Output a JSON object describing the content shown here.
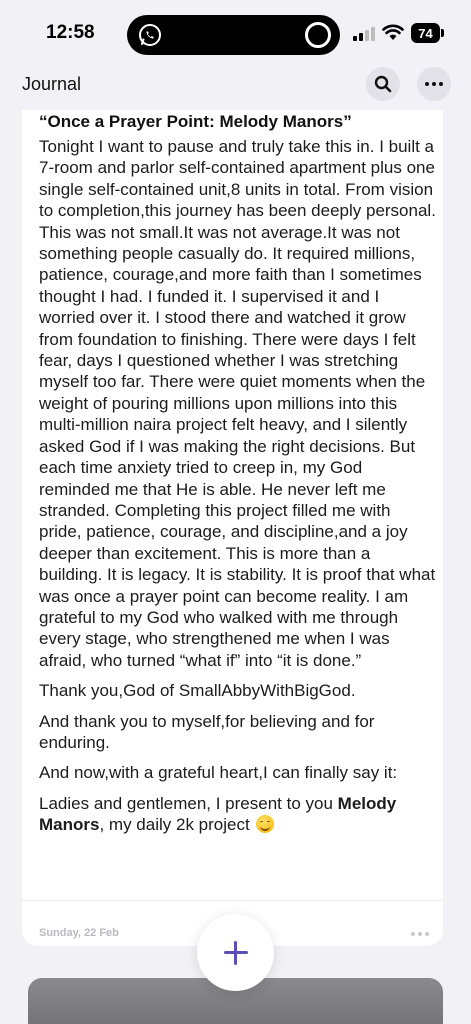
{
  "status_bar": {
    "time": "12:58",
    "battery": "74",
    "icons": [
      "whatsapp-icon",
      "ring-icon",
      "signal-icon",
      "wifi-icon",
      "battery-icon"
    ]
  },
  "nav": {
    "title": "Journal",
    "actions": [
      "search-icon",
      "more-icon"
    ]
  },
  "entry": {
    "title": "“Once a Prayer Point: Melody Manors”",
    "body": "Tonight I want to pause and truly take this in. I built a 7-room and parlor self-contained apartment plus one single self-contained unit,8 units in total. From vision to completion,this journey has been deeply personal. This was not small.It was not average.It was not something people casually do. It required millions, patience, courage,and more faith than I sometimes thought I had. I funded it. I supervised it and I worried over it. I stood there and watched it grow from foundation to finishing. There were days I felt fear, days I questioned whether I was stretching myself too far. There were quiet moments when the weight of pouring millions upon millions into this multi-million naira project felt heavy, and I silently asked God if I was making the right decisions. But each time anxiety tried to creep in, my God reminded me that He is able. He never left me stranded. Completing  this project filled me with pride, patience, courage, and discipline,and a joy deeper than excitement. This is more than a building. It is legacy. It is stability. It is proof that what was once a prayer point can become reality. I am grateful to my God who walked with me through every stage, who strengthened me when I was afraid, who turned “what if” into “it is done.”",
    "para2": "Thank you,God of SmallAbbyWithBigGod.",
    "para3": "And thank you to myself,for believing and for enduring.",
    "para4": "And now,with a grateful heart,I can finally say it:",
    "para5_pre": "Ladies and gentlemen, I present to you ",
    "para5_bold": "Melody Manors",
    "para5_post": ", my daily 2k project ",
    "emoji": "smiling-face-emoji",
    "date": "Sunday, 22 Feb"
  },
  "colors": {
    "background": "#f2f1f6",
    "card": "#ffffff",
    "accent": "#5a4fb5"
  }
}
